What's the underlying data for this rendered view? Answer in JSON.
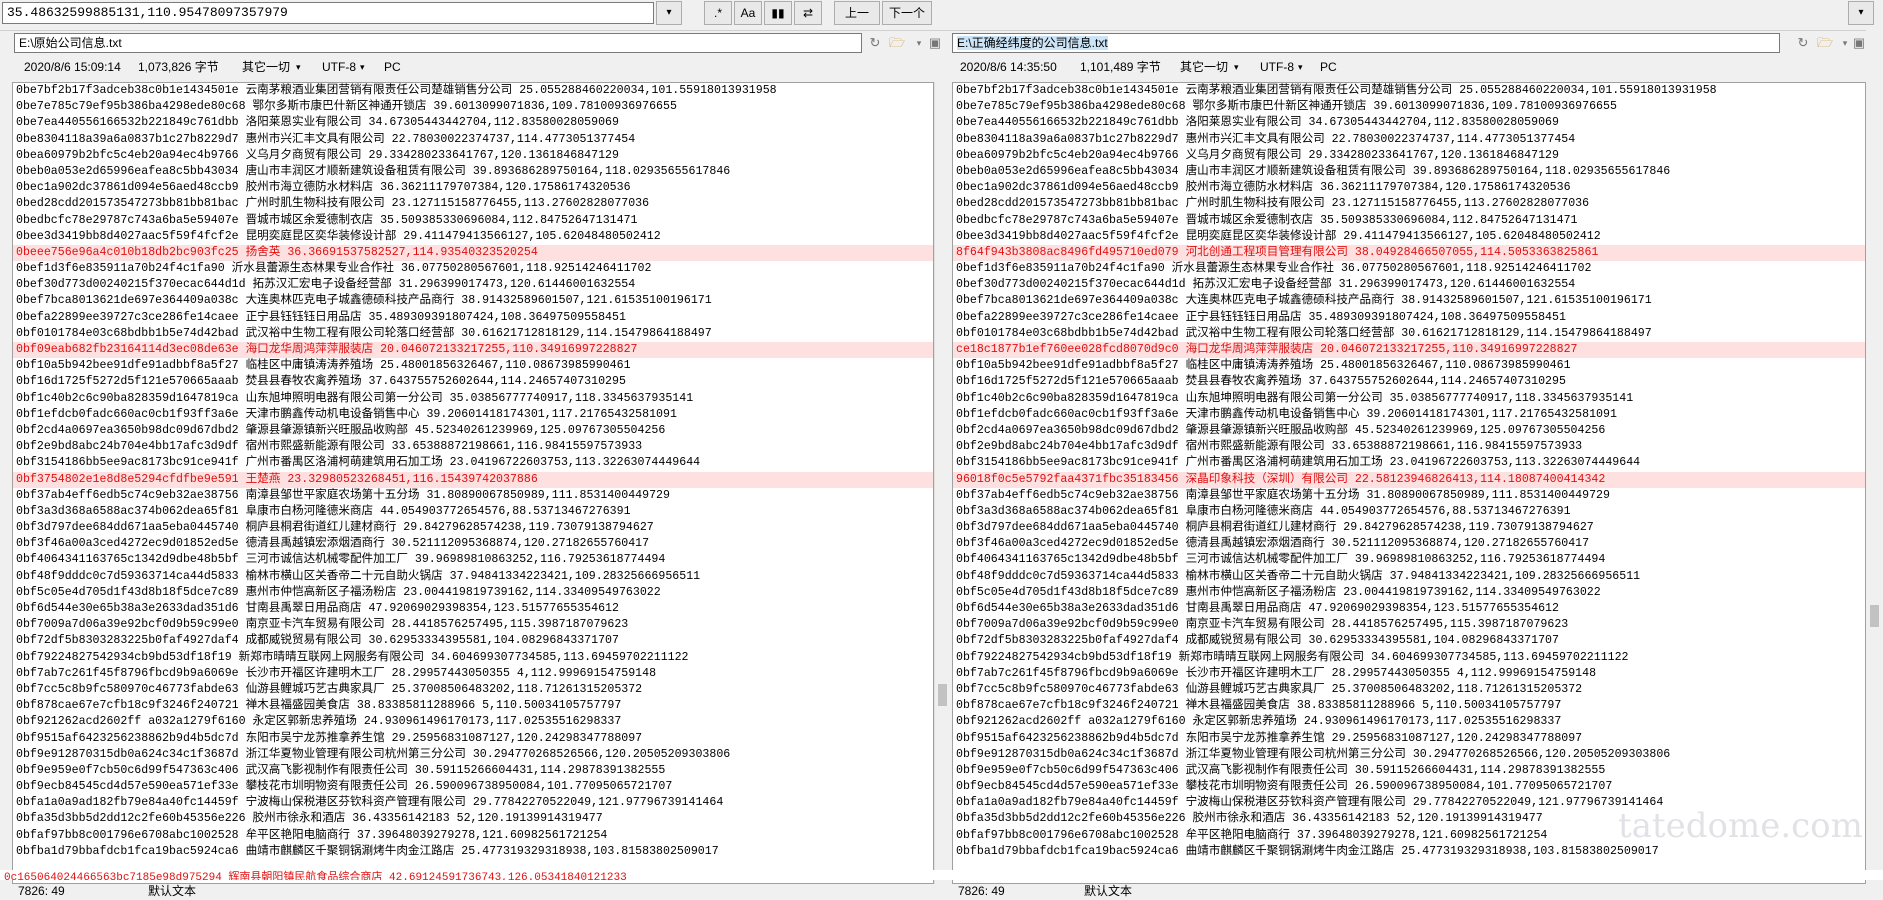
{
  "toolbar": {
    "search_value": "35.48632599885131,110.95478097357979",
    "btn_dropdown": "▾",
    "btn_regex": ".*",
    "btn_case": "Aa",
    "btn_word": "▮▮",
    "btn_wrap": "⇄",
    "btn_prev": "上一",
    "btn_next": "下一个"
  },
  "left": {
    "path": "E:\\原始公司信息.txt",
    "date": "2020/8/6 15:09:14",
    "size": "1,073,826 字节",
    "eol": "其它一切",
    "encoding": "UTF-8",
    "platform": "PC",
    "status_pos": "7826: 49",
    "status_mode": "默认文本",
    "lines": [
      "0be7bf2b17f3adceb38c0b1e1434501e 云南茅粮酒业集团营销有限责任公司楚雄销售分公司 25.055288460220034,101.55918013931958",
      "0be7e785c79ef95b386ba4298ede80c68 鄂尔多斯市康巴什新区神通开锁店 39.6013099071836,109.78100936976655",
      "0be7ea440556166532b221849c761dbb 洛阳莱恩实业有限公司 34.67305443442704,112.83580028059069",
      "0be8304118a39a6a0837b1c27b8229d7 惠州市兴汇丰文具有限公司 22.78030022374737,114.4773051377454",
      "0bea60979b2bfc5c4eb20a94ec4b9766 义乌月夕商贸有限公司 29.334280233641767,120.1361846847129",
      "0beb0a053e2d65996eafea8c5bb43034 唐山市丰润区才顺新建筑设备租赁有限公司 39.893686289750164,118.02935655617846",
      "0bec1a902dc37861d094e56aed48ccb9 胶州市海立德防水材料店 36.36211179707384,120.17586174320536",
      "0bed28cdd201573547273bb81bb81bac 广州时肌生物科技有限公司 23.127115158776455,113.27602828077036",
      "0bedbcfc78e29787c743a6ba5e59407e 晋城市城区余爱德制衣店 35.509385330696084,112.84752647131471",
      "0bee3d3419bb8d4027aac5f59f4fcf2e 昆明奕庭昆区奕华装修设计部 29.411479413566127,105.62048480502412",
      "0beee756e96a4c010b18db2bc903fc25 扬舍英 36.36691537582527,114.93540323520254",
      "0bef1d3f6e835911a70b24f4c1fa90 沂水县蕾源生态林果专业合作社 36.07750280567601,118.92514246411702",
      "0bef30d773d00240215f370ecac644d1d 拓苏汉汇宏电子设备经营部 31.296399017473,120.61446001632554",
      "0bef7bca8013621de697e364409a038c 大连奥林匹克电子城鑫德硕科技产品商行 38.91432589601507,121.61535100196171",
      "0befa22899ee39727c3ce286fe14caee 正宁县钰钰钰日用品店 35.489309391807424,108.36497509558451",
      "0bf0101784e03c68bdbb1b5e74d42bad 武汉裕中生物工程有限公司轮落口经营部 30.61621712818129,114.15479864188497",
      "0bf09eab682fb23164114d3ec08de63e 海口龙华周鸿萍萍服装店 20.046072133217255,110.34916997228827",
      "0bf10a5b942bee91dfe91adbbf8a5f27 临桂区中庸镇涛涛养殖场 25.48001856326467,110.08673985990461",
      "0bf16d1725f5272d5f121e570665aaab 焚县县春牧农禽养殖场 37.643755752602644,114.24657407310295",
      "0bf1c40b2c6c90ba828359d1647819ca 山东旭坤照明电器有限公司第一分公司 35.03856777740917,118.3345637935141",
      "0bf1efdcb0fadc660ac0cb1f93ff3a6e 天津市鹏鑫传动机电设备销售中心 39.20601418174301,117.21765432581091",
      "0bf2cd4a0697ea3650b98dc09d67dbd2 肇源县肇源镇新兴旺服品收购部 45.52340261239969,125.09767305504256",
      "0bf2e9bd8abc24b704e4bb17afc3d9df 宿州市熙盛新能源有限公司 33.65388872198661,116.98415597573933",
      "0bf3154186bb5ee9ac8173bc91ce941f 广州市番禺区洛浦柯萌建筑用石加工场 23.04196722603753,113.32263074449644",
      "0bf3754802e1e8d8e5294cfdfbe9e591 王楚燕 23.32980523268451,116.15439742037886",
      "0bf37ab4eff6edb5c74c9eb32ae38756 南漳县邹世平家庭农场第十五分场 31.80890067850989,111.8531400449729",
      "0bf3a3d368a6588ac374b062dea65f81 阜康市白杨河隆德米商店 44.054903772654576,88.53713467276391",
      "0bf3d797dee684dd671aa5eba0445740 桐庐县桐君街道红儿建材商行 29.84279628574238,119.73079138794627",
      "0bf3f46a00a3ced4272ec9d01852ed5e 德清县禹越镇宏添烟酒商行 30.521112095368874,120.27182655760417",
      "0bf4064341163765c1342d9dbe48b5bf 三河市诚信达机械零配件加工厂 39.96989810863252,116.79253618774494",
      "0bf48f9dddc0c7d59363714ca44d5833 榆林市横山区关香帝二十元自助火锅店 37.94841334223421,109.28325666956511",
      "0bf5c05e4d705d1f43d8b18f5dce7c89 惠州市仲恺高新区子福汤粉店 23.004419819739162,114.33409549763022",
      "0bf6d544e30e65b38a3e2633dad351d6 甘南县禹翠日用品商店 47.92069029398354,123.51577655354612",
      "0bf7009a7d06a39e92bcf0d9b59c99e0 南京亚卡汽车贸易有限公司 28.4418576257495,115.3987187079623",
      "0bf72df5b8303283225b0faf4927daf4 成都威锐贸易有限公司 30.62953334395581,104.08296843371707",
      "0bf79224827542934cb9bd53df18f19 新郑市晴晴互联网上网服务有限公司 34.604699307734585,113.69459702211122",
      "0bf7ab7c261f45f8796fbcd9b9a6069e 长沙市开福区许建明木工厂 28.29957443050355 4,112.99969154759148",
      "0bf7cc5c8b9fc580970c46773fabde63 仙游县鲤城巧艺古典家具厂 25.37008506483202,118.71261315205372",
      "0bf878cae67e7cfb18c9f3246f240721 禅木县福盛园美食店 38.83385811288966 5,110.50034105757797",
      "0bf921262acd2602ff a032a1279f6160 永定区郭新忠养殖场 24.930961496170173,117.02535516298337",
      "0bf9515af6423256238862b9d4b5dc7d 东阳市吴宁龙苏推拿养生馆 29.25956831087127,120.24298347788097",
      "0bf9e912870315db0a624c34c1f3687d 浙江华夏物业管理有限公司杭州第三分公司 30.294770268526566,120.20505209303806",
      "0bf9e959e0f7cb50c6d99f547363c406 武汉高飞影视制作有限责任公司 30.59115266604431,114.29878391382555",
      "0bf9ecb84545cd4d57e590ea571ef33e 攀枝花市圳明物资有限责任公司 26.590096738950084,101.77095065721707",
      "0bfa1a0a9ad182fb79e84a40fc14459f 宁波梅山保税港区芬钦科资产管理有限公司 29.77842270522049,121.97796739141464",
      "0bfa35d3bb5d2dd12c2fe60b45356e226 胶州市徐永和酒店 36.43356142183 52,120.19139914319477",
      "0bfaf97bb8c001796e6708abc1002528 牟平区艳阳电脑商行 37.39648039279278,121.60982561721254",
      "0bfba1d79bbafdcb1fca19bac5924ca6 曲靖市麒麟区千聚铜锅涮烤牛肉金江路店 25.477319329318938,103.81583802509017"
    ],
    "diff_lines": [
      10,
      16,
      24
    ]
  },
  "right": {
    "path": "E:\\正确经纬度的公司信息.txt",
    "date": "2020/8/6 14:35:50",
    "size": "1,101,489 字节",
    "eol": "其它一切",
    "encoding": "UTF-8",
    "platform": "PC",
    "status_pos": "7826: 49",
    "status_mode": "默认文本",
    "lines": [
      "0be7bf2b17f3adceb38c0b1e1434501e 云南茅粮酒业集团营销有限责任公司楚雄销售分公司 25.055288460220034,101.55918013931958",
      "0be7e785c79ef95b386ba4298ede80c68 鄂尔多斯市康巴什新区神通开锁店 39.6013099071836,109.78100936976655",
      "0be7ea440556166532b221849c761dbb 洛阳莱恩实业有限公司 34.67305443442704,112.83580028059069",
      "0be8304118a39a6a0837b1c27b8229d7 惠州市兴汇丰文具有限公司 22.78030022374737,114.4773051377454",
      "0bea60979b2bfc5c4eb20a94ec4b9766 义乌月夕商贸有限公司 29.334280233641767,120.1361846847129",
      "0beb0a053e2d65996eafea8c5bb43034 唐山市丰润区才顺新建筑设备租赁有限公司 39.893686289750164,118.02935655617846",
      "0bec1a902dc37861d094e56aed48ccb9 胶州市海立德防水材料店 36.36211179707384,120.17586174320536",
      "0bed28cdd201573547273bb81bb81bac 广州时肌生物科技有限公司 23.127115158776455,113.27602828077036",
      "0bedbcfc78e29787c743a6ba5e59407e 晋城市城区余爱德制衣店 35.509385330696084,112.84752647131471",
      "0bee3d3419bb8d4027aac5f59f4fcf2e 昆明奕庭昆区奕华装修设计部 29.411479413566127,105.62048480502412",
      "8f64f943b3808ac8496fd495710ed079 河北创通工程项目管理有限公司 38.04928466507055,114.5053363825861",
      "0bef1d3f6e835911a70b24f4c1fa90 沂水县蕾源生态林果专业合作社 36.07750280567601,118.92514246411702",
      "0bef30d773d00240215f370ecac644d1d 拓苏汉汇宏电子设备经营部 31.296399017473,120.61446001632554",
      "0bef7bca8013621de697e364409a038c 大连奥林匹克电子城鑫德硕科技产品商行 38.91432589601507,121.61535100196171",
      "0befa22899ee39727c3ce286fe14caee 正宁县钰钰钰日用品店 35.489309391807424,108.36497509558451",
      "0bf0101784e03c68bdbb1b5e74d42bad 武汉裕中生物工程有限公司轮落口经营部 30.61621712818129,114.15479864188497",
      "ce18c1877b1ef760ee028fcd8070d9c0 海口龙华周鸿萍萍服装店 20.046072133217255,110.34916997228827",
      "0bf10a5b942bee91dfe91adbbf8a5f27 临桂区中庸镇涛涛养殖场 25.48001856326467,110.08673985990461",
      "0bf16d1725f5272d5f121e570665aaab 焚县县春牧农禽养殖场 37.643755752602644,114.24657407310295",
      "0bf1c40b2c6c90ba828359d1647819ca 山东旭坤照明电器有限公司第一分公司 35.03856777740917,118.3345637935141",
      "0bf1efdcb0fadc660ac0cb1f93ff3a6e 天津市鹏鑫传动机电设备销售中心 39.20601418174301,117.21765432581091",
      "0bf2cd4a0697ea3650b98dc09d67dbd2 肇源县肇源镇新兴旺服品收购部 45.52340261239969,125.09767305504256",
      "0bf2e9bd8abc24b704e4bb17afc3d9df 宿州市熙盛新能源有限公司 33.65388872198661,116.98415597573933",
      "0bf3154186bb5ee9ac8173bc91ce941f 广州市番禺区洛浦柯萌建筑用石加工场 23.04196722603753,113.32263074449644",
      "96018f0c5e5792faa4371fbc35183456 深晶印象科技（深圳）有限公司 22.58123946826413,114.18087400414342",
      "0bf37ab4eff6edb5c74c9eb32ae38756 南漳县邹世平家庭农场第十五分场 31.80890067850989,111.8531400449729",
      "0bf3a3d368a6588ac374b062dea65f81 阜康市白杨河隆德米商店 44.054903772654576,88.53713467276391",
      "0bf3d797dee684dd671aa5eba0445740 桐庐县桐君街道红儿建材商行 29.84279628574238,119.73079138794627",
      "0bf3f46a00a3ced4272ec9d01852ed5e 德清县禹越镇宏添烟酒商行 30.521112095368874,120.27182655760417",
      "0bf4064341163765c1342d9dbe48b5bf 三河市诚信达机械零配件加工厂 39.96989810863252,116.79253618774494",
      "0bf48f9dddc0c7d59363714ca44d5833 榆林市横山区关香帝二十元自助火锅店 37.94841334223421,109.28325666956511",
      "0bf5c05e4d705d1f43d8b18f5dce7c89 惠州市仲恺高新区子福汤粉店 23.004419819739162,114.33409549763022",
      "0bf6d544e30e65b38a3e2633dad351d6 甘南县禹翠日用品商店 47.92069029398354,123.51577655354612",
      "0bf7009a7d06a39e92bcf0d9b59c99e0 南京亚卡汽车贸易有限公司 28.4418576257495,115.3987187079623",
      "0bf72df5b8303283225b0faf4927daf4 成都威锐贸易有限公司 30.62953334395581,104.08296843371707",
      "0bf79224827542934cb9bd53df18f19 新郑市晴晴互联网上网服务有限公司 34.604699307734585,113.69459702211122",
      "0bf7ab7c261f45f8796fbcd9b9a6069e 长沙市开福区许建明木工厂 28.29957443050355 4,112.99969154759148",
      "0bf7cc5c8b9fc580970c46773fabde63 仙游县鲤城巧艺古典家具厂 25.37008506483202,118.71261315205372",
      "0bf878cae67e7cfb18c9f3246f240721 禅木县福盛园美食店 38.83385811288966 5,110.50034105757797",
      "0bf921262acd2602ff a032a1279f6160 永定区郭新忠养殖场 24.930961496170173,117.02535516298337",
      "0bf9515af6423256238862b9d4b5dc7d 东阳市吴宁龙苏推拿养生馆 29.25956831087127,120.24298347788097",
      "0bf9e912870315db0a624c34c1f3687d 浙江华夏物业管理有限公司杭州第三分公司 30.294770268526566,120.20505209303806",
      "0bf9e959e0f7cb50c6d99f547363c406 武汉高飞影视制作有限责任公司 30.59115266604431,114.29878391382555",
      "0bf9ecb84545cd4d57e590ea571ef33e 攀枝花市圳明物资有限责任公司 26.590096738950084,101.77095065721707",
      "0bfa1a0a9ad182fb79e84a40fc14459f 宁波梅山保税港区芬钦科资产管理有限公司 29.77842270522049,121.97796739141464",
      "0bfa35d3bb5d2dd12c2fe60b45356e226 胶州市徐永和酒店 36.43356142183 52,120.19139914319477",
      "0bfaf97bb8c001796e6708abc1002528 牟平区艳阳电脑商行 37.39648039279278,121.60982561721254",
      "0bfba1d79bbafdcb1fca19bac5924ca6 曲靖市麒麟区千聚铜锅涮烤牛肉金江路店 25.477319329318938,103.81583802509017"
    ],
    "diff_lines": [
      10,
      16,
      24
    ]
  },
  "bottom_line": "0c165064024466563bc7185e98d975294 辉南县朝阳镇民航食品综合商店 42.69124591736743,126.05341840121233",
  "watermark": "tatedome.com",
  "colors": {
    "diff_bg": "#ffe0e0",
    "diff_text": "#e01010",
    "selection": "#cce4f7"
  }
}
